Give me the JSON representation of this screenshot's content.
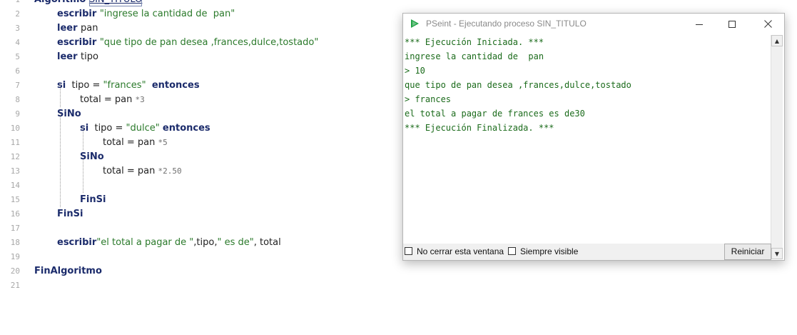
{
  "editor": {
    "lines": [
      {
        "n": "1",
        "parts": [
          {
            "t": "Algoritmo ",
            "c": "kw"
          },
          {
            "t": "SIN_TITULO",
            "c": "uline"
          }
        ]
      },
      {
        "n": "2",
        "parts": [
          {
            "t": "escribir ",
            "c": "kw"
          },
          {
            "t": "\"ingrese la cantidad de  pan\"",
            "c": "str"
          }
        ]
      },
      {
        "n": "3",
        "parts": [
          {
            "t": "leer ",
            "c": "kw"
          },
          {
            "t": "pan",
            "c": "plain"
          }
        ]
      },
      {
        "n": "4",
        "parts": [
          {
            "t": "escribir ",
            "c": "kw"
          },
          {
            "t": "\"que tipo de pan desea ,frances,dulce,tostado\"",
            "c": "str"
          }
        ]
      },
      {
        "n": "5",
        "parts": [
          {
            "t": "leer ",
            "c": "kw"
          },
          {
            "t": "tipo",
            "c": "plain"
          }
        ]
      },
      {
        "n": "6",
        "parts": []
      },
      {
        "n": "7",
        "parts": [
          {
            "t": "si",
            "c": "kw"
          },
          {
            "t": "  tipo = ",
            "c": "plain"
          },
          {
            "t": "\"frances\"",
            "c": "str"
          },
          {
            "t": "  ",
            "c": "plain"
          },
          {
            "t": "entonces",
            "c": "kw"
          }
        ]
      },
      {
        "n": "8",
        "parts": [
          {
            "t": "total = pan ",
            "c": "plain"
          },
          {
            "t": "*3",
            "c": "num"
          }
        ]
      },
      {
        "n": "9",
        "parts": [
          {
            "t": "SiNo",
            "c": "kw"
          }
        ]
      },
      {
        "n": "10",
        "parts": [
          {
            "t": "si",
            "c": "kw"
          },
          {
            "t": "  tipo = ",
            "c": "plain"
          },
          {
            "t": "\"dulce\"",
            "c": "str"
          },
          {
            "t": " ",
            "c": "plain"
          },
          {
            "t": "entonces",
            "c": "kw"
          }
        ]
      },
      {
        "n": "11",
        "parts": [
          {
            "t": "total = pan ",
            "c": "plain"
          },
          {
            "t": "*5",
            "c": "num"
          }
        ]
      },
      {
        "n": "12",
        "parts": [
          {
            "t": "SiNo",
            "c": "kw"
          }
        ]
      },
      {
        "n": "13",
        "parts": [
          {
            "t": "total = pan ",
            "c": "plain"
          },
          {
            "t": "*2.50",
            "c": "num"
          }
        ]
      },
      {
        "n": "14",
        "parts": []
      },
      {
        "n": "15",
        "parts": [
          {
            "t": "FinSi",
            "c": "kw"
          }
        ]
      },
      {
        "n": "16",
        "parts": [
          {
            "t": "FinSi",
            "c": "kw"
          }
        ]
      },
      {
        "n": "17",
        "parts": []
      },
      {
        "n": "18",
        "parts": [
          {
            "t": "escribir",
            "c": "kw"
          },
          {
            "t": "\"el total a pagar de \"",
            "c": "str"
          },
          {
            "t": ",tipo,",
            "c": "plain"
          },
          {
            "t": "\" es de\"",
            "c": "str"
          },
          {
            "t": ", total",
            "c": "plain"
          }
        ]
      },
      {
        "n": "19",
        "parts": []
      },
      {
        "n": "20",
        "parts": [
          {
            "t": "FinAlgoritmo",
            "c": "kw"
          }
        ]
      },
      {
        "n": "21",
        "parts": []
      }
    ]
  },
  "console": {
    "title": "PSeint - Ejecutando proceso SIN_TITULO",
    "icon": "pseint-logo-icon",
    "accent": "#22a447",
    "output_color": "#1b6b1b",
    "output": [
      "*** Ejecución Iniciada. ***",
      "ingrese la cantidad de  pan",
      "> 10",
      "que tipo de pan desea ,frances,dulce,tostado",
      "> frances",
      "el total a pagar de frances es de30",
      "*** Ejecución Finalizada. ***"
    ],
    "footer": {
      "no_close_label": "No cerrar esta ventana",
      "no_close_checked": false,
      "always_visible_label": "Siempre visible",
      "always_visible_checked": false,
      "restart_label": "Reiniciar"
    }
  }
}
